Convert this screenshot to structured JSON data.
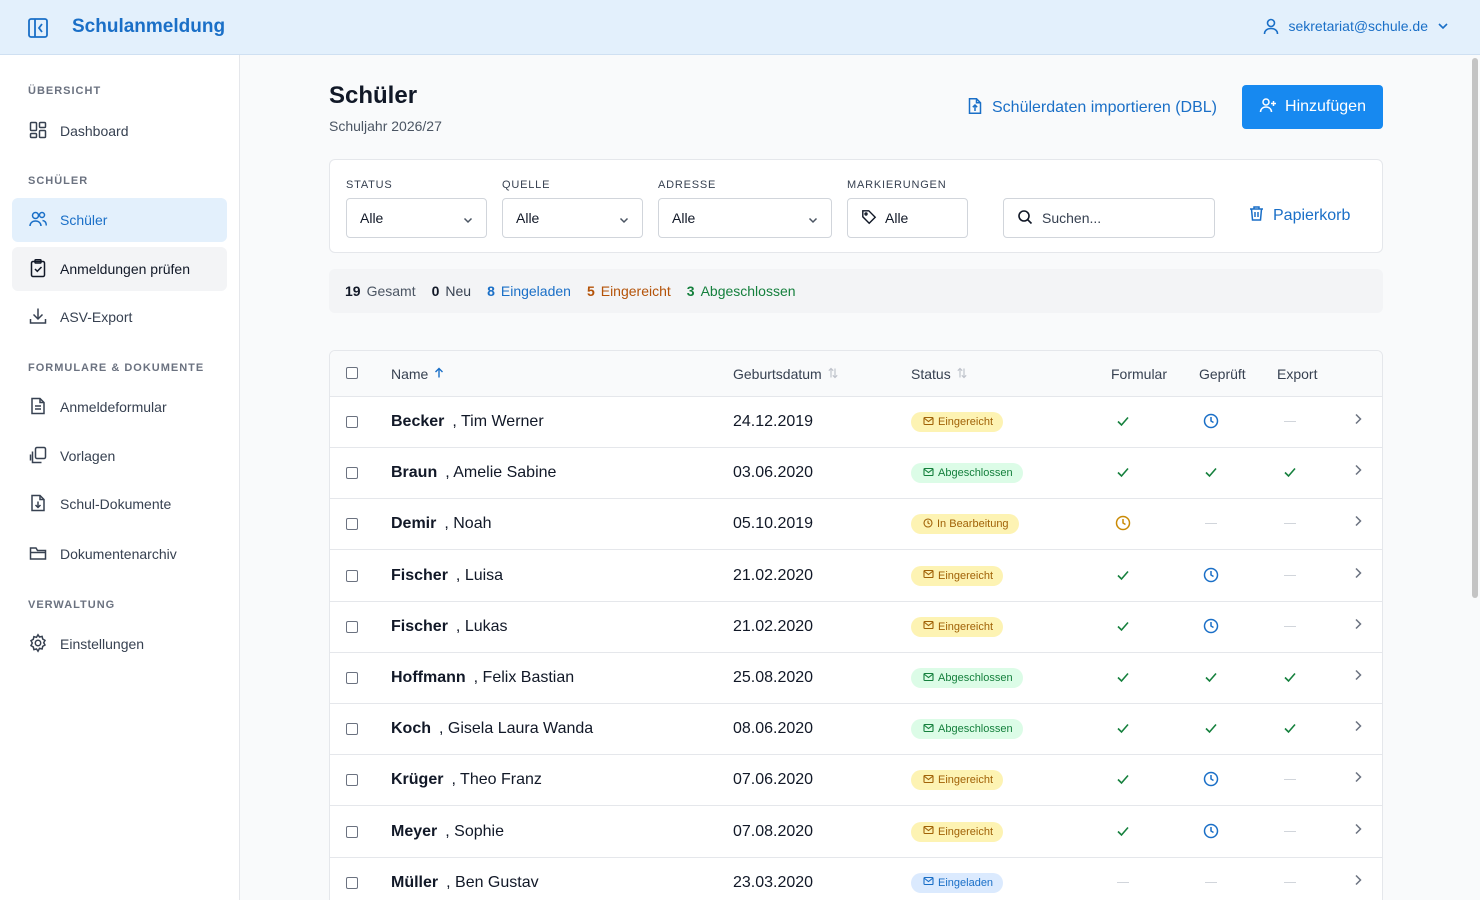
{
  "header": {
    "app_title": "Schulanmeldung",
    "user_email": "sekretariat@schule.de",
    "accent_color": "#1a6fc7"
  },
  "sidebar": {
    "sections": [
      {
        "label": "ÜBERSICHT"
      },
      {
        "label": "SCHÜLER"
      },
      {
        "label": "FORMULARE & DOKUMENTE"
      },
      {
        "label": "VERWALTUNG"
      }
    ],
    "items": [
      {
        "label": "Dashboard",
        "icon": "dashboard-icon"
      },
      {
        "label": "Schüler",
        "icon": "users-icon",
        "active": true
      },
      {
        "label": "Anmeldungen prüfen",
        "icon": "clipboard-check-icon"
      },
      {
        "label": "ASV-Export",
        "icon": "download-icon"
      },
      {
        "label": "Anmeldeformular",
        "icon": "document-icon"
      },
      {
        "label": "Vorlagen",
        "icon": "copy-icon"
      },
      {
        "label": "Schul-Dokumente",
        "icon": "file-download-icon"
      },
      {
        "label": "Dokumentenarchiv",
        "icon": "folder-icon"
      },
      {
        "label": "Einstellungen",
        "icon": "gear-icon"
      }
    ]
  },
  "page": {
    "title": "Schüler",
    "subtitle": "Schuljahr 2026/27",
    "import_label": "Schülerdaten importieren (DBL)",
    "add_label": "Hinzufügen"
  },
  "filters": {
    "status": {
      "label": "STATUS",
      "value": "Alle"
    },
    "quelle": {
      "label": "QUELLE",
      "value": "Alle"
    },
    "adresse": {
      "label": "ADRESSE",
      "value": "Alle"
    },
    "markierungen": {
      "label": "MARKIERUNGEN",
      "value": "Alle"
    },
    "search_placeholder": "Suchen...",
    "trash_label": "Papierkorb"
  },
  "stats": {
    "total": {
      "count": "19",
      "label": "Gesamt"
    },
    "neu": {
      "count": "0",
      "label": "Neu"
    },
    "eingeladen": {
      "count": "8",
      "label": "Eingeladen"
    },
    "eingereicht": {
      "count": "5",
      "label": "Eingereicht"
    },
    "abgeschlossen": {
      "count": "3",
      "label": "Abgeschlossen"
    }
  },
  "table": {
    "columns": {
      "name": "Name",
      "dob": "Geburtsdatum",
      "status": "Status",
      "formular": "Formular",
      "geprueft": "Geprüft",
      "export": "Export"
    },
    "rows": [
      {
        "last": "Becker",
        "first": ", Tim Werner",
        "dob": "24.12.2019",
        "status": "Eingereicht",
        "status_kind": "eingereicht",
        "formular": "check",
        "geprueft": "clock",
        "export": "dash"
      },
      {
        "last": "Braun",
        "first": ", Amelie Sabine",
        "dob": "03.06.2020",
        "status": "Abgeschlossen",
        "status_kind": "abgeschlossen",
        "formular": "check",
        "geprueft": "check",
        "export": "check"
      },
      {
        "last": "Demir",
        "first": ", Noah",
        "dob": "05.10.2019",
        "status": "In Bearbeitung",
        "status_kind": "inbearbeitung",
        "formular": "clock-amber",
        "geprueft": "dash",
        "export": "dash"
      },
      {
        "last": "Fischer",
        "first": ", Luisa",
        "dob": "21.02.2020",
        "status": "Eingereicht",
        "status_kind": "eingereicht",
        "formular": "check",
        "geprueft": "clock",
        "export": "dash"
      },
      {
        "last": "Fischer",
        "first": ", Lukas",
        "dob": "21.02.2020",
        "status": "Eingereicht",
        "status_kind": "eingereicht",
        "formular": "check",
        "geprueft": "clock",
        "export": "dash"
      },
      {
        "last": "Hoffmann",
        "first": ", Felix Bastian",
        "dob": "25.08.2020",
        "status": "Abgeschlossen",
        "status_kind": "abgeschlossen",
        "formular": "check",
        "geprueft": "check",
        "export": "check"
      },
      {
        "last": "Koch",
        "first": ", Gisela Laura Wanda",
        "dob": "08.06.2020",
        "status": "Abgeschlossen",
        "status_kind": "abgeschlossen",
        "formular": "check",
        "geprueft": "check",
        "export": "check"
      },
      {
        "last": "Krüger",
        "first": ", Theo Franz",
        "dob": "07.06.2020",
        "status": "Eingereicht",
        "status_kind": "eingereicht",
        "formular": "check",
        "geprueft": "clock",
        "export": "dash"
      },
      {
        "last": "Meyer",
        "first": ", Sophie",
        "dob": "07.08.2020",
        "status": "Eingereicht",
        "status_kind": "eingereicht",
        "formular": "check",
        "geprueft": "clock",
        "export": "dash"
      },
      {
        "last": "Müller",
        "first": ", Ben Gustav",
        "dob": "23.03.2020",
        "status": "Eingeladen",
        "status_kind": "eingeladen",
        "formular": "dash",
        "geprueft": "dash",
        "export": "dash"
      }
    ]
  }
}
